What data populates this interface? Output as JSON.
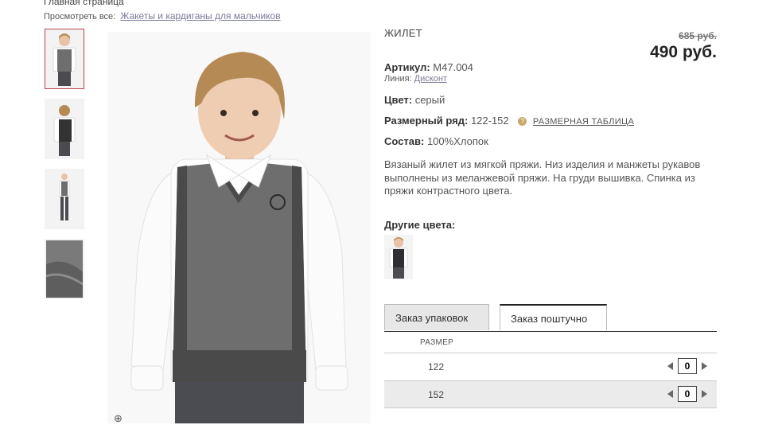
{
  "breadcrumb": {
    "home": "Главная страница"
  },
  "see_all": {
    "label": "Просмотреть все:",
    "link": "Жакеты и кардиганы для мальчиков"
  },
  "product": {
    "title": "ЖИЛЕТ",
    "old_price": "685 руб.",
    "price": "490 руб.",
    "article_label": "Артикул:",
    "article_value": "M47.004",
    "line_label": "Линия:",
    "line_value": "Дисконт",
    "color_label": "Цвет:",
    "color_value": "серый",
    "size_label": "Размерный ряд:",
    "size_value": "122-152",
    "size_table": "РАЗМЕРНАЯ ТАБЛИЦА",
    "composition_label": "Состав:",
    "composition_value": "100%Хлопок",
    "description": "Вязаный жилет из мягкой пряжи. Низ изделия и манжеты рукавов выполнены из меланжевой пряжи. На груди вышивка. Спинка из пряжи контрастного цвета.",
    "other_colors": "Другие цвета:"
  },
  "tabs": [
    {
      "label": "Заказ упаковок"
    },
    {
      "label": "Заказ поштучно"
    }
  ],
  "table": {
    "header": "РАЗМЕР",
    "rows": [
      {
        "size": "122",
        "qty": "0"
      },
      {
        "size": "152",
        "qty": "0"
      }
    ]
  },
  "colors": {
    "accent": "#b9434f",
    "vest": "#6e6e6e",
    "vest_dark": "#4a4a4a"
  }
}
